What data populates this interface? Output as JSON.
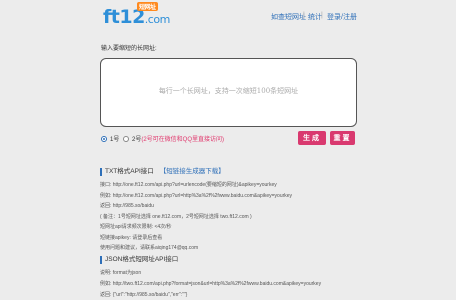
{
  "header": {
    "logo_text": "ft12",
    "logo_domain": ".com",
    "logo_badge": "短网址",
    "nav": [
      {
        "label": "如查短网址"
      },
      {
        "label": "统计"
      },
      {
        "label": "登录/注册"
      }
    ]
  },
  "form": {
    "prompt": "输入要缩短的长网址:",
    "placeholder": "每行一个长网址，支持一次缩短100条短网址",
    "option1": "1号",
    "option2": "2号",
    "option2_note": "(2号可在微信和QQ里直接访问)",
    "generate_label": "生成",
    "reset_label": "重置"
  },
  "txt_section": {
    "title": "TXT格式API接口",
    "tag": "【短链接生成器下载】",
    "lines": [
      "接口: http://one.ft12.com/api.php?url=urlencode(要缩短的网址)&apikey=yourkey",
      "例如: http://one.ft12.com/api.php?url=http%3a%2f%2fwww.baidu.com&apikey=yourkey",
      "返回: http://985.so/baidu",
      "( 备注：1号短网址选择 one.ft12.com，2号短网址选择 two.ft12.com )",
      "短网址api请求频次限制: <4次/秒",
      "短链接apikey: 请登录后查看",
      "使用问题和建议，请联系aiqing174@qq.com"
    ]
  },
  "json_section": {
    "title": "JSON格式短网址API接口",
    "lines": [
      "说明: format为json",
      "例如: http://two.ft12.com/api.php?format=json&url=http%3a%2f%2fwww.baidu.com&apikey=yourkey",
      "返回: {\"url\":\"http://985.so/baidu\",\"err\":\"\"}"
    ]
  }
}
